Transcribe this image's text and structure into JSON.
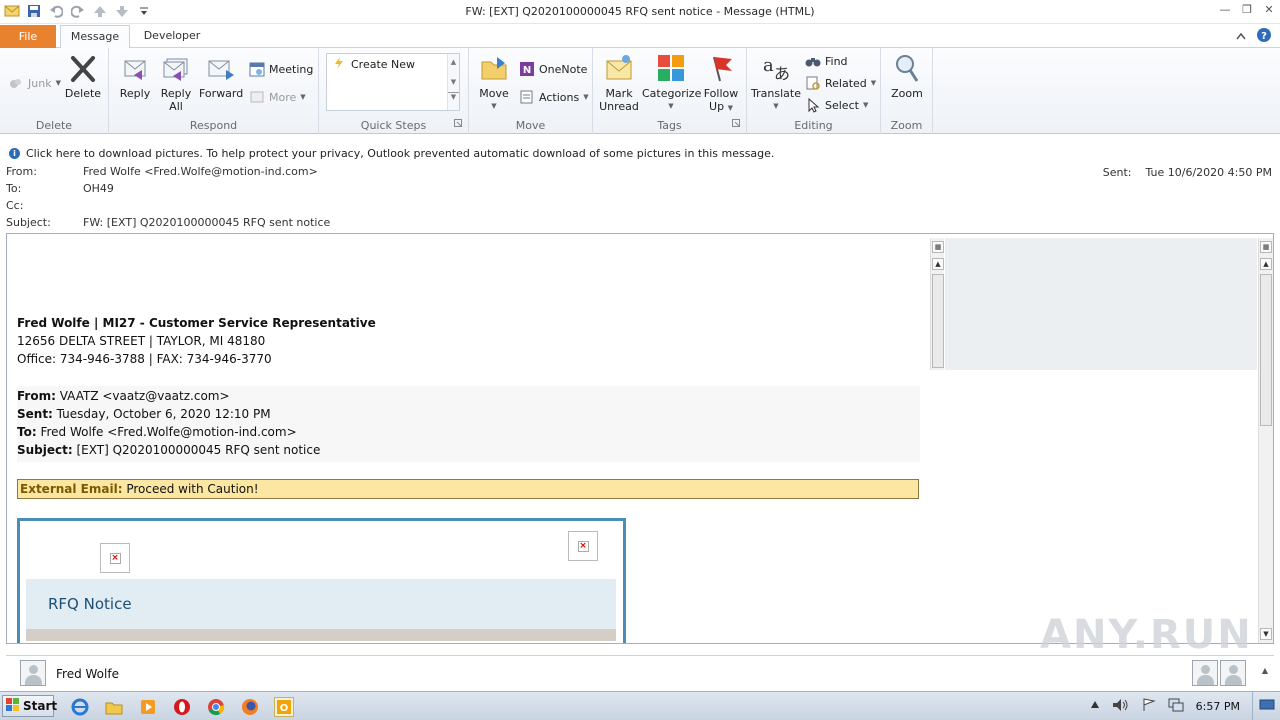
{
  "window": {
    "title": "FW: [EXT] Q2020100000045 RFQ sent notice  -  Message (HTML)"
  },
  "tabs": {
    "file": "File",
    "message": "Message",
    "developer": "Developer"
  },
  "ribbon": {
    "delete_group": {
      "label": "Delete",
      "junk": "Junk",
      "delete": "Delete"
    },
    "respond_group": {
      "label": "Respond",
      "reply": "Reply",
      "reply_all_line1": "Reply",
      "reply_all_line2": "All",
      "forward": "Forward",
      "meeting": "Meeting",
      "more": "More"
    },
    "quick_steps_group": {
      "label": "Quick Steps",
      "create_new": "Create New"
    },
    "move_group": {
      "label": "Move",
      "move": "Move",
      "onenote": "OneNote",
      "actions": "Actions"
    },
    "tags_group": {
      "label": "Tags",
      "mark_unread_line1": "Mark",
      "mark_unread_line2": "Unread",
      "categorize": "Categorize",
      "follow_up_line1": "Follow",
      "follow_up_line2": "Up"
    },
    "editing_group": {
      "label": "Editing",
      "translate": "Translate",
      "find": "Find",
      "related": "Related",
      "select": "Select"
    },
    "zoom_group": {
      "label": "Zoom",
      "zoom": "Zoom"
    }
  },
  "infobar": {
    "text": "Click here to download pictures. To help protect your privacy, Outlook prevented automatic download of some pictures in this message."
  },
  "header": {
    "from_label": "From:",
    "from_value": "Fred Wolfe <Fred.Wolfe@motion-ind.com>",
    "to_label": "To:",
    "to_value": "OH49",
    "cc_label": "Cc:",
    "subject_label": "Subject:",
    "subject_value": "FW: [EXT] Q2020100000045 RFQ sent notice",
    "sent_label": "Sent:",
    "sent_value": "Tue 10/6/2020 4:50 PM"
  },
  "body": {
    "signature": {
      "name": "Fred Wolfe | MI27 - Customer Service Representative",
      "address": "12656 DELTA STREET | TAYLOR, MI 48180",
      "phones": "Office: 734-946-3788 | FAX: 734-946-3770"
    },
    "forwarded": {
      "from_label": "From:",
      "from_value": " VAATZ <vaatz@vaatz.com>",
      "sent_label": "Sent:",
      "sent_value": " Tuesday, October 6, 2020 12:10 PM",
      "to_label": "To:",
      "to_value": " Fred Wolfe <Fred.Wolfe@motion-ind.com>",
      "subject_label": "Subject:",
      "subject_value": " [EXT] Q2020100000045 RFQ sent notice"
    },
    "external_banner": {
      "label": "External Email:",
      "text": " Proceed with Caution!"
    },
    "rfq_card": {
      "title": "RFQ Notice"
    }
  },
  "people_pane": {
    "name": "Fred Wolfe"
  },
  "watermark": "ANY.RUN",
  "taskbar": {
    "start": "Start",
    "clock": "6:57 PM"
  },
  "colors": {
    "file_tab": "#e9822f",
    "external_banner_bg": "#fbe7a1",
    "rfq_border": "#4a8db7",
    "rfq_title": "#1d4f75"
  }
}
